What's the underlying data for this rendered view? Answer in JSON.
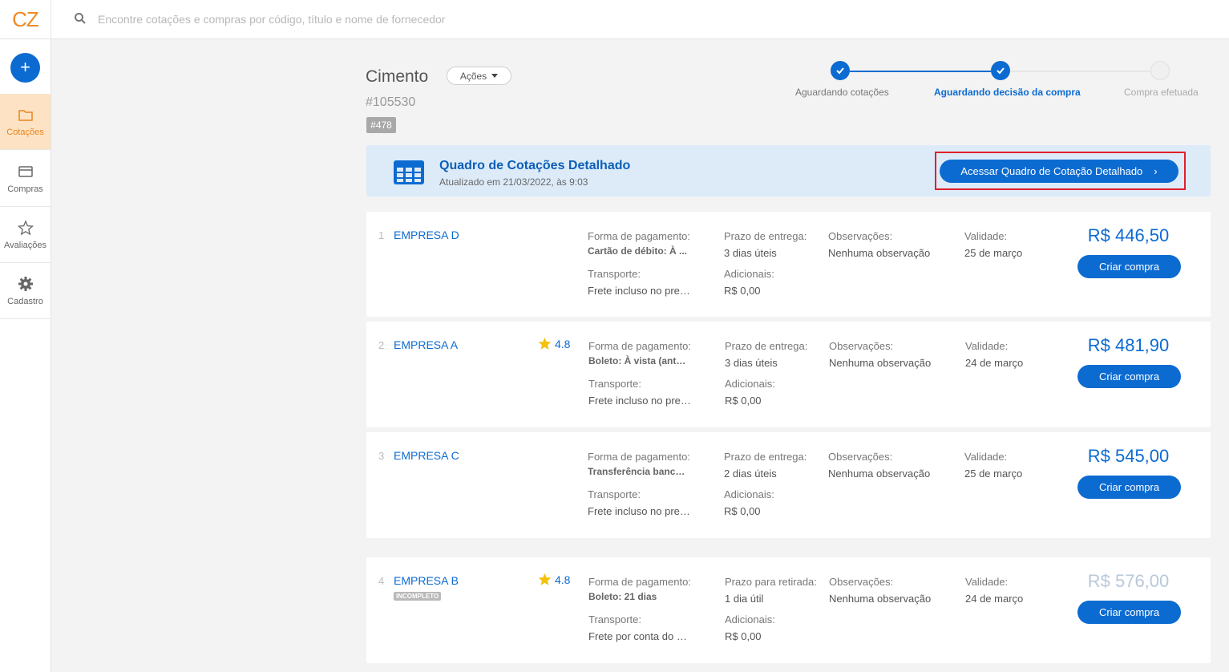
{
  "app": {
    "logo": "CZ"
  },
  "search": {
    "placeholder": "Encontre cotações e compras por código, título e nome de fornecedor"
  },
  "sidebar": {
    "add_label": "+",
    "items": [
      {
        "label": "Cotações",
        "icon": "folder-icon",
        "active": true
      },
      {
        "label": "Compras",
        "icon": "card-icon"
      },
      {
        "label": "Avaliações",
        "icon": "star-icon"
      },
      {
        "label": "Cadastro",
        "icon": "gear-icon"
      }
    ]
  },
  "header": {
    "title": "Cimento",
    "actions_label": "Ações",
    "code": "#105530",
    "tag": "#478"
  },
  "stepper": {
    "steps": [
      {
        "label": "Aguardando cotações",
        "state": "done"
      },
      {
        "label": "Aguardando decisão da compra",
        "state": "current"
      },
      {
        "label": "Compra efetuada",
        "state": "todo"
      }
    ]
  },
  "banner": {
    "title": "Quadro de Cotações Detalhado",
    "subtitle": "Atualizado em 21/03/2022, às 9:03",
    "button_label": "Acessar Quadro de Cotação Detalhado",
    "button_chevron": "›"
  },
  "labels": {
    "payment": "Forma de pagamento:",
    "transport": "Transporte:",
    "additional": "Adicionais:",
    "observations": "Observações:",
    "validity": "Validade:",
    "buy": "Criar compra"
  },
  "quotes": [
    {
      "num": "1",
      "company": "EMPRESA D",
      "rating": "",
      "badge": "",
      "payment": "Cartão de débito: À ...",
      "transport": "Frete incluso no preç...",
      "delivery_label": "Prazo de entrega:",
      "delivery": "3 dias úteis",
      "additional": "R$ 0,00",
      "observations": "Nenhuma observação",
      "validity": "25 de março",
      "price": "R$ 446,50"
    },
    {
      "num": "2",
      "company": "EMPRESA A",
      "rating": "4.8",
      "badge": "",
      "payment": "Boleto: À vista (ante...",
      "transport": "Frete incluso no preç...",
      "delivery_label": "Prazo de entrega:",
      "delivery": "3 dias úteis",
      "additional": "R$ 0,00",
      "observations": "Nenhuma observação",
      "validity": "24 de março",
      "price": "R$ 481,90"
    },
    {
      "num": "3",
      "company": "EMPRESA C",
      "rating": "",
      "badge": "",
      "payment": "Transferência bancá...",
      "transport": "Frete incluso no preç...",
      "delivery_label": "Prazo de entrega:",
      "delivery": "2 dias úteis",
      "additional": "R$ 0,00",
      "observations": "Nenhuma observação",
      "validity": "25 de março",
      "price": "R$ 545,00"
    },
    {
      "num": "4",
      "company": "EMPRESA B",
      "rating": "4.8",
      "badge": "INCOMPLETO",
      "payment": "Boleto: 21 dias",
      "transport": "Frete por conta do cl...",
      "delivery_label": "Prazo para retirada:",
      "delivery": "1 dia útil",
      "additional": "R$ 0,00",
      "observations": "Nenhuma observação",
      "validity": "24 de março",
      "price": "R$ 576,00"
    }
  ],
  "colors": {
    "accent": "#0c6bd1",
    "brand": "#f08a24",
    "highlight": "#e0202a",
    "rating_star": "#f4c20d"
  }
}
